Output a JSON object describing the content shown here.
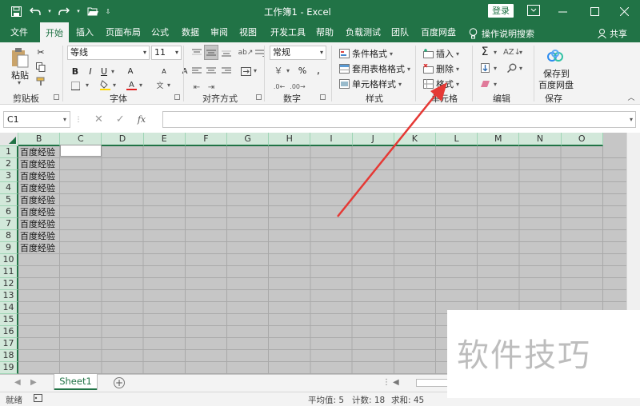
{
  "titlebar": {
    "title": "工作簿1  -  Excel",
    "login": "登录"
  },
  "tabs": [
    {
      "label": "文件"
    },
    {
      "label": "开始"
    },
    {
      "label": "插入"
    },
    {
      "label": "页面布局"
    },
    {
      "label": "公式"
    },
    {
      "label": "数据"
    },
    {
      "label": "审阅"
    },
    {
      "label": "视图"
    },
    {
      "label": "开发工具"
    },
    {
      "label": "帮助"
    },
    {
      "label": "负载测试"
    },
    {
      "label": "团队"
    },
    {
      "label": "百度网盘"
    }
  ],
  "tell_me": "操作说明搜索",
  "share": "共享",
  "ribbon": {
    "clipboard": {
      "label": "剪贴板",
      "paste": "粘贴"
    },
    "font": {
      "label": "字体",
      "name": "等线",
      "size": "11",
      "bold": "B",
      "italic": "I",
      "underline": "U"
    },
    "alignment": {
      "label": "对齐方式"
    },
    "number": {
      "label": "数字",
      "format": "常规"
    },
    "styles": {
      "label": "样式",
      "conditional": "条件格式",
      "table": "套用表格格式",
      "cell": "单元格样式"
    },
    "cells": {
      "label": "单元格",
      "insert": "插入",
      "delete": "删除",
      "format": "格式"
    },
    "editing": {
      "label": "编辑"
    },
    "save": {
      "label": "保存",
      "button_line1": "保存到",
      "button_line2": "百度网盘"
    }
  },
  "formula_bar": {
    "name_box": "C1",
    "fx": "fx",
    "value": ""
  },
  "columns": [
    "B",
    "C",
    "D",
    "E",
    "F",
    "G",
    "H",
    "I",
    "J",
    "K",
    "L",
    "M",
    "N",
    "O"
  ],
  "rows": [
    "1",
    "2",
    "3",
    "4",
    "5",
    "6",
    "7",
    "8",
    "9",
    "10",
    "11",
    "12",
    "13",
    "14",
    "15",
    "16",
    "17",
    "18",
    "19"
  ],
  "cells_b": [
    "百度经验",
    "百度经验",
    "百度经验",
    "百度经验",
    "百度经验",
    "百度经验",
    "百度经验",
    "百度经验",
    "百度经验"
  ],
  "sheets": [
    {
      "name": "Sheet1"
    }
  ],
  "status": {
    "ready": "就绪",
    "average": "平均值: 5",
    "count": "计数: 18",
    "sum": "求和: 45"
  },
  "watermark": "软件技巧",
  "colors": {
    "excel_green": "#217346",
    "arrow_red": "#e53935"
  }
}
